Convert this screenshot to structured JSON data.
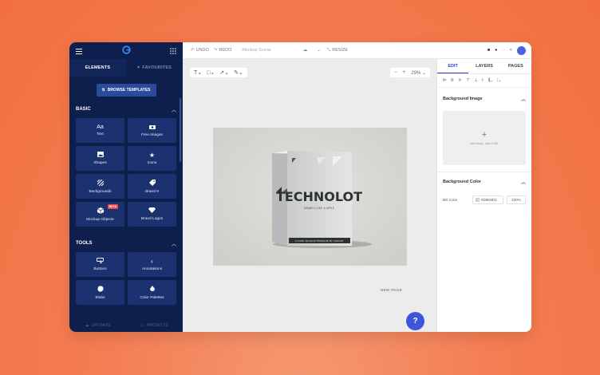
{
  "sidebar": {
    "tabs": [
      {
        "label": "ELEMENTS",
        "active": true
      },
      {
        "label": "FAVOURITES",
        "active": false
      }
    ],
    "browse_templates": "BROWSE TEMPLATES",
    "basic": {
      "title": "BASIC",
      "tiles": [
        {
          "label": "Text",
          "icon": "text-icon"
        },
        {
          "label": "Free Images",
          "icon": "camera-icon"
        },
        {
          "label": "Shapes",
          "icon": "shapes-icon"
        },
        {
          "label": "Icons",
          "icon": "star-icon"
        },
        {
          "label": "Backgrounds",
          "icon": "backgrounds-icon"
        },
        {
          "label": "Brand It",
          "icon": "tag-icon"
        },
        {
          "label": "Mockup Objects",
          "icon": "cube-icon",
          "badge": "BETA"
        },
        {
          "label": "Brand Logos",
          "icon": "diamond-icon"
        }
      ]
    },
    "tools": {
      "title": "TOOLS",
      "tiles": [
        {
          "label": "Buttons",
          "icon": "button-icon"
        },
        {
          "label": "Annotations",
          "icon": "arrow-icon"
        },
        {
          "label": "Blobs",
          "icon": "blob-icon"
        },
        {
          "label": "Color Palettes",
          "icon": "palette-icon"
        }
      ]
    },
    "bottom": {
      "uploads": "UPLOADS",
      "projects": "PROJECTS"
    }
  },
  "toolbar": {
    "undo": "UNDO",
    "redo": "REDO",
    "scene_name": "Mockup Scene",
    "resize": "RESIZE"
  },
  "canvas": {
    "zoom": "29%",
    "new_page": "NEW PAGE",
    "help": "?",
    "product": {
      "brand": "TECHNOLOT",
      "subtitle": "BRAND // LIKE A APPLE",
      "footer": "LUXURY MOCKUP TEMPLATE BY CODIUM"
    }
  },
  "right_panel": {
    "tabs": [
      {
        "label": "EDIT",
        "active": true
      },
      {
        "label": "LAYERS",
        "active": false
      },
      {
        "label": "PAGES",
        "active": false
      }
    ],
    "background_image": {
      "title": "Background Image",
      "hint": "Add image. Max 4 Mb."
    },
    "background_color": {
      "title": "Background Color",
      "label": "BG Color",
      "value": "#D8D8D1",
      "opacity": "100%"
    }
  },
  "colors": {
    "sidebar": "#0f1f4d",
    "accent": "#3d55d9",
    "background": "#f47e54"
  }
}
